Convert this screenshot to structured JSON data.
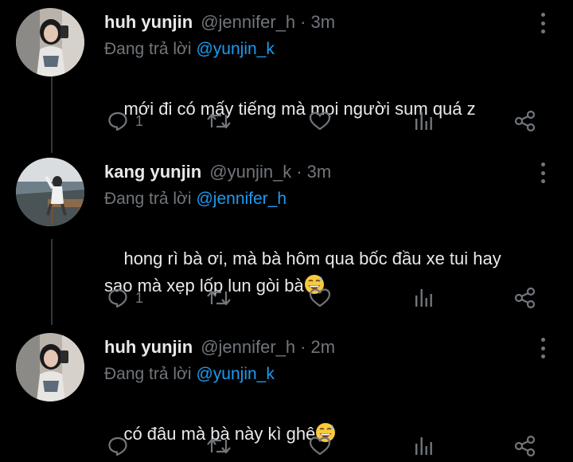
{
  "tweets": [
    {
      "name": "huh yunjin",
      "handle": "@jennifer_h",
      "time": "3m",
      "reply_prefix": "Đang trả lời",
      "reply_to": "@yunjin_k",
      "text": "mới đi có mấy tiếng mà mọi người sum quá z",
      "emoji": "",
      "reply_count": "1"
    },
    {
      "name": "kang yunjin",
      "handle": "@yunjin_k",
      "time": "3m",
      "reply_prefix": "Đang trả lời",
      "reply_to": "@jennifer_h",
      "text": "hong rì bà ơi, mà bà hôm qua bốc đầu xe tui hay\nsao mà xẹp lốp lun gòi bà",
      "emoji": "😅",
      "reply_count": "1"
    },
    {
      "name": "huh yunjin",
      "handle": "@jennifer_h",
      "time": "2m",
      "reply_prefix": "Đang trả lời",
      "reply_to": "@yunjin_k",
      "text": "có đâu mà bà này kì ghê",
      "emoji": "😅",
      "reply_count": ""
    }
  ],
  "separator": "·",
  "icons": {
    "reply": "reply-icon",
    "retweet": "retweet-icon",
    "like": "heart-icon",
    "analytics": "analytics-icon",
    "share": "share-icon",
    "more": "more-options-icon"
  },
  "colors": {
    "background": "#000000",
    "text": "#e7e9ea",
    "muted": "#71767b",
    "link": "#1d9bf0",
    "thread_line": "#333639"
  }
}
